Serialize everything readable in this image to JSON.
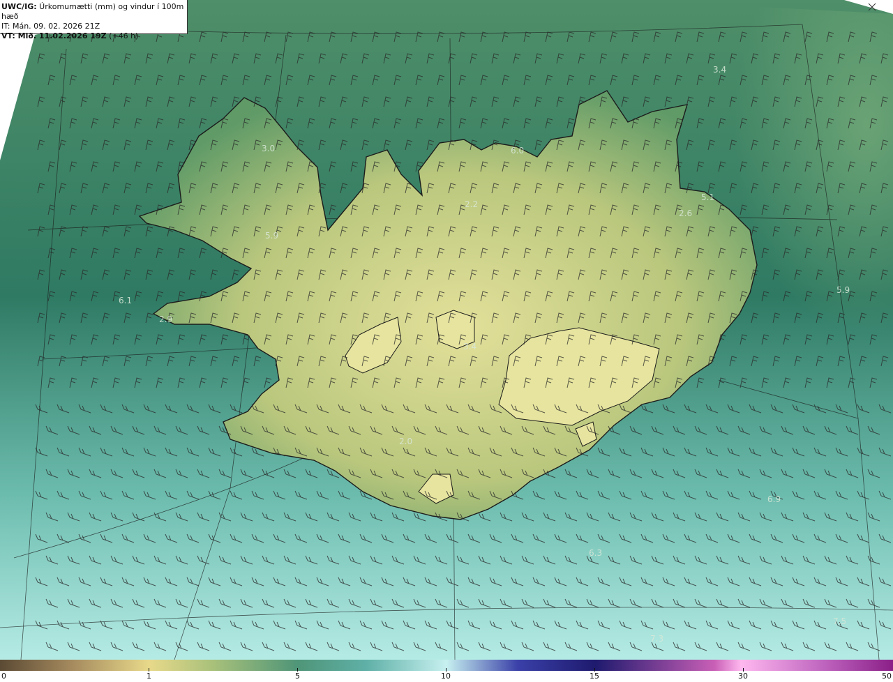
{
  "header": {
    "model": "UWC/IG:",
    "title": " Úrkomumætti (mm) og vindur í 100m hæð",
    "init_time": "IT: Mán. 09. 02. 2026 21Z",
    "valid_label": "VT: Mið. 11.02.2026 19Z",
    "valid_offset": " (+46 h)"
  },
  "legend": {
    "ticks": [
      "0",
      "1",
      "5",
      "10",
      "15",
      "30",
      "50"
    ]
  },
  "map_values": [
    "3.4",
    "3.0",
    "6.0",
    "2.2",
    "5.1",
    "2.6",
    "5.9",
    "6.1",
    "2.9",
    "5.9",
    "3.4",
    "2.0",
    "6.9",
    "6.3",
    "7.5",
    "7.3"
  ],
  "colors": {
    "land_high": "#d8dc8e",
    "land_low": "#4e8f62",
    "sea_north": "#3d8a66",
    "sea_south": "#a7e3dc",
    "coast": "#1c1c1c"
  }
}
